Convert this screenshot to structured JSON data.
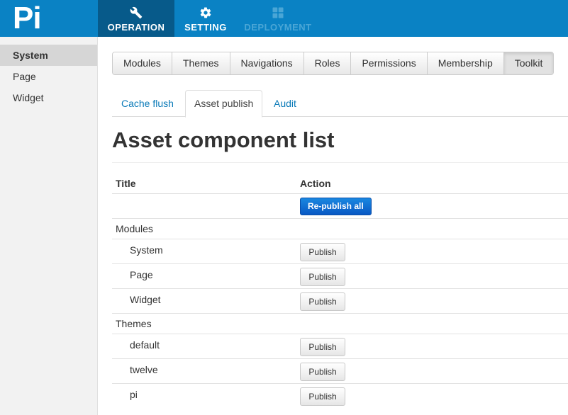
{
  "app": {
    "logo": "Pi"
  },
  "topnav": [
    {
      "label": "OPERATION",
      "icon": "wrench-icon",
      "active": true
    },
    {
      "label": "SETTING",
      "icon": "gear-icon",
      "active": false
    },
    {
      "label": "DEPLOYMENT",
      "icon": "grid-icon",
      "active": false,
      "disabled": true
    }
  ],
  "sidebar": {
    "items": [
      {
        "label": "System",
        "active": true
      },
      {
        "label": "Page",
        "active": false
      },
      {
        "label": "Widget",
        "active": false
      }
    ]
  },
  "toolbar": {
    "buttons": [
      "Modules",
      "Themes",
      "Navigations",
      "Roles",
      "Permissions",
      "Membership",
      "Toolkit"
    ],
    "active": "Toolkit"
  },
  "tabs": {
    "items": [
      "Cache flush",
      "Asset publish",
      "Audit"
    ],
    "active": "Asset publish"
  },
  "page": {
    "title": "Asset component list"
  },
  "table": {
    "headers": {
      "title": "Title",
      "action": "Action"
    },
    "republish_label": "Re-publish all",
    "publish_label": "Publish",
    "groups": [
      {
        "name": "Modules",
        "items": [
          "System",
          "Page",
          "Widget"
        ]
      },
      {
        "name": "Themes",
        "items": [
          "default",
          "twelve",
          "pi"
        ]
      }
    ]
  },
  "colors": {
    "brand": "#0a82c4",
    "brand_dark": "#075a8a",
    "link": "#0a7ab8",
    "primary_button": "#0a63cc"
  }
}
